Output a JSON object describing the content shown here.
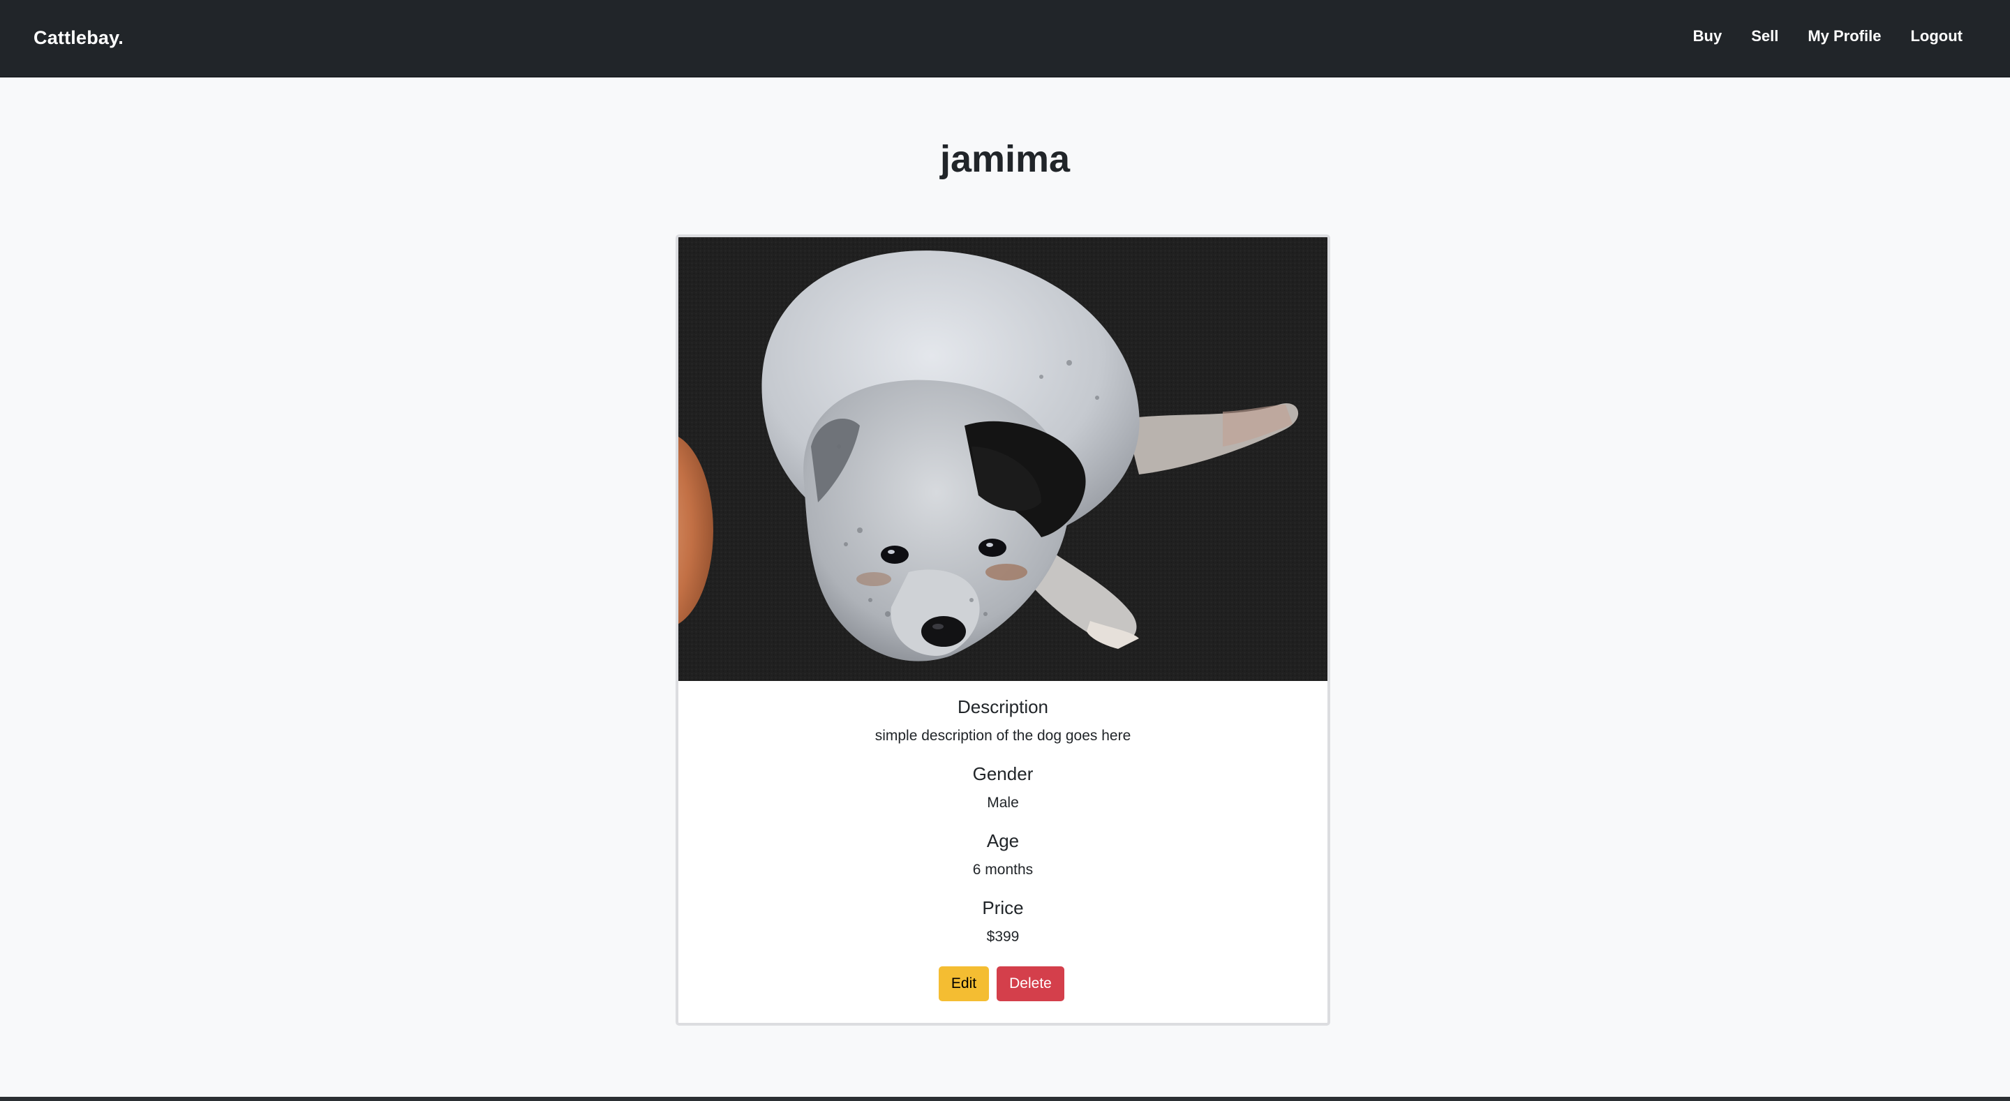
{
  "navbar": {
    "brand": "Cattlebay.",
    "links": [
      {
        "label": "Buy"
      },
      {
        "label": "Sell"
      },
      {
        "label": "My Profile"
      },
      {
        "label": "Logout"
      }
    ],
    "background": "#212529"
  },
  "listing": {
    "title": "jamima",
    "fields": [
      {
        "heading": "Description",
        "value": "simple description of the dog goes here"
      },
      {
        "heading": "Gender",
        "value": "Male"
      },
      {
        "heading": "Age",
        "value": "6 months"
      },
      {
        "heading": "Price",
        "value": "$399"
      }
    ],
    "actions": {
      "edit_label": "Edit",
      "delete_label": "Delete"
    }
  },
  "colors": {
    "page_background": "#f8f9fa",
    "edit_button": "#f4bd32",
    "delete_button": "#d43f4b"
  }
}
